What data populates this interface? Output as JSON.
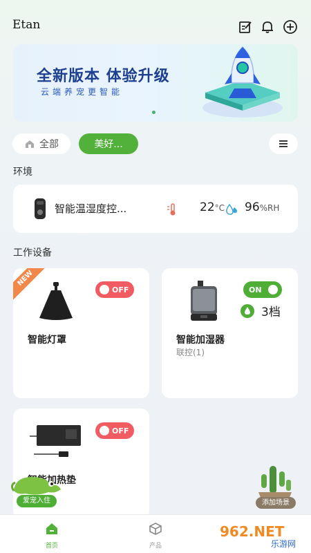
{
  "header": {
    "username": "Etan"
  },
  "banner": {
    "title": "全新版本 体验升级",
    "subtitle": "云端养宠更智能"
  },
  "filters": {
    "all_label": "全部",
    "favorite_label": "美好..."
  },
  "sections": {
    "environment": "环境",
    "devices": "工作设备"
  },
  "environment": {
    "name": "智能温湿度控...",
    "temperature": "22",
    "temperature_unit": "°C",
    "humidity": "96",
    "humidity_unit": "%RH"
  },
  "devices": [
    {
      "name": "智能灯罩",
      "badge": "NEW",
      "toggle": "OFF",
      "sub": ""
    },
    {
      "name": "智能加湿器",
      "toggle": "ON",
      "sub": "联控(1)",
      "level": "3档"
    },
    {
      "name": "智能加热垫",
      "toggle": "OFF",
      "sub": ""
    }
  ],
  "floating": {
    "pet_button": "爱宠入住",
    "scene_button": "添加场景"
  },
  "tabbar": {
    "home": "首页",
    "products": "产品"
  },
  "watermark": {
    "brand": "962.NET",
    "sub": "乐游网"
  },
  "colors": {
    "accent": "#52b13a",
    "off": "#f15b62",
    "banner_title": "#1d3f8f"
  }
}
